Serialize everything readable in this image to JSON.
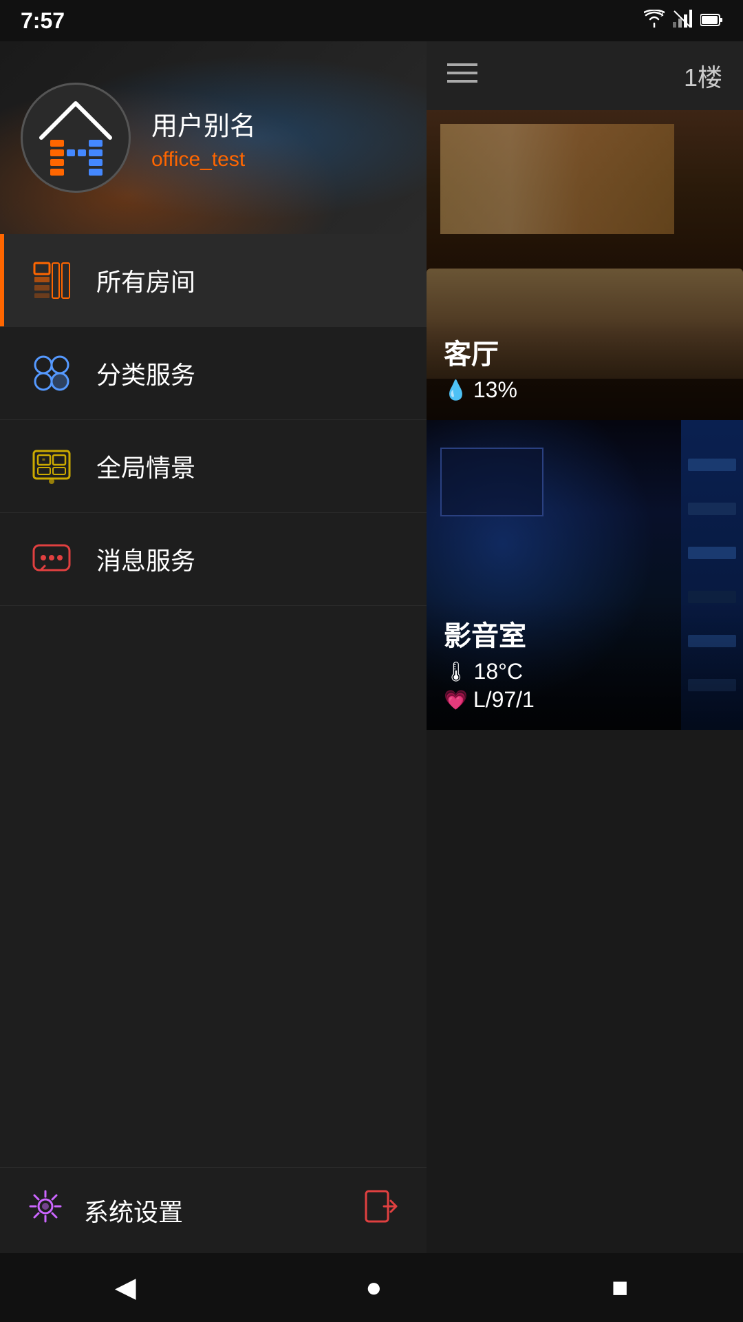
{
  "statusBar": {
    "time": "7:57",
    "icons": [
      "wifi",
      "signal",
      "battery"
    ]
  },
  "sidebar": {
    "userLabel": "用户别名",
    "userName": "office_test",
    "menuItems": [
      {
        "id": "all-rooms",
        "label": "所有房间",
        "active": true
      },
      {
        "id": "category-service",
        "label": "分类服务",
        "active": false
      },
      {
        "id": "global-scene",
        "label": "全局情景",
        "active": false
      },
      {
        "id": "message-service",
        "label": "消息服务",
        "active": false
      }
    ],
    "footer": {
      "settingsLabel": "系统设置"
    }
  },
  "rightPanel": {
    "floorLabel": "1楼",
    "rooms": [
      {
        "id": "living-room",
        "name": "客厅",
        "stat1": "13%",
        "stat1Icon": "💧"
      },
      {
        "id": "theater",
        "name": "影音室",
        "stat1": "18°C",
        "stat1Icon": "🌡",
        "stat2": "L/97/1",
        "stat2Icon": "💗"
      }
    ]
  },
  "navBar": {
    "back": "◀",
    "home": "●",
    "recent": "■"
  }
}
